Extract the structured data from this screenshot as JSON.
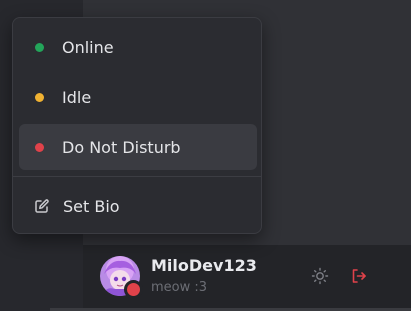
{
  "status_menu": {
    "items": [
      {
        "label": "Online",
        "color": "#23a55a"
      },
      {
        "label": "Idle",
        "color": "#f0b232"
      },
      {
        "label": "Do Not Disturb",
        "color": "#e0424a"
      }
    ],
    "set_bio_label": "Set Bio"
  },
  "user": {
    "username": "MiloDev123",
    "bio": "meow :3",
    "status_color": "#e0424a"
  },
  "icons": {
    "theme": "sun-icon",
    "logout": "logout-icon",
    "bio": "edit-icon"
  },
  "colors": {
    "logout_accent": "#e0424a"
  }
}
